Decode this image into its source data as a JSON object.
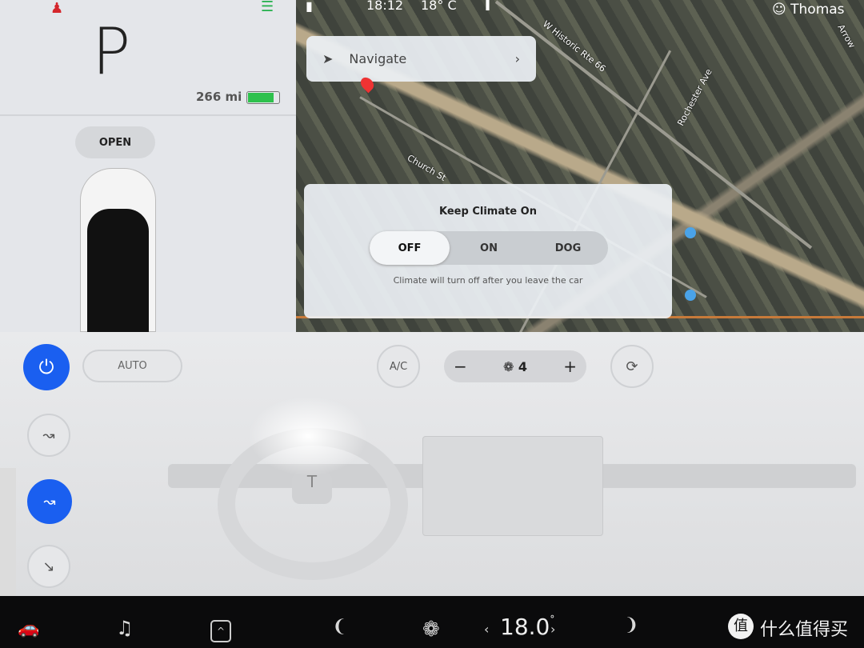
{
  "status": {
    "gear": "P",
    "range": "266 mi",
    "battery_percent": 85,
    "time": "18:12",
    "temp": "18° C",
    "user": "Thomas",
    "seatbelt_icon": "seatbelt-warning-icon",
    "headlight_icon": "headlight-icon"
  },
  "car": {
    "frunk_label": "OPEN"
  },
  "map": {
    "navigate_label": "Navigate",
    "streets": [
      "W Historic Rte 66",
      "Rochester Ave",
      "Church St",
      "Arrow"
    ]
  },
  "keep_climate": {
    "title": "Keep Climate On",
    "options": [
      "OFF",
      "ON",
      "DOG"
    ],
    "selected": "OFF",
    "description": "Climate will turn off after you leave the car"
  },
  "climate": {
    "auto_label": "AUTO",
    "ac_label": "A/C",
    "fan_speed": "4",
    "minus": "−",
    "plus": "+",
    "power_color": "#1a5ff0"
  },
  "bottom_bar": {
    "temperature": "18.0",
    "temp_unit": "°",
    "watermark": "什么值得买",
    "watermark_logo": "值"
  }
}
